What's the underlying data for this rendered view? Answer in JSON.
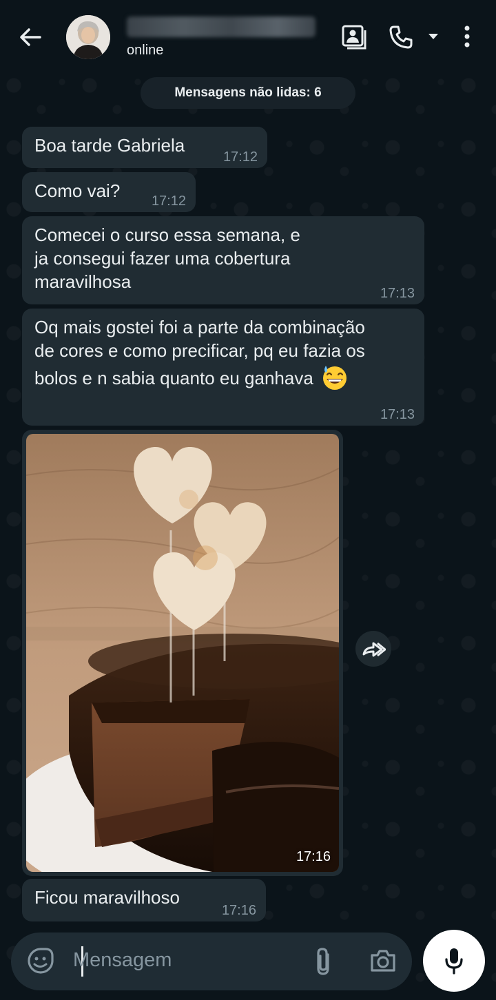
{
  "header": {
    "status": "online",
    "icons": [
      "back-arrow-icon",
      "contact-card-icon",
      "phone-icon",
      "dropdown-caret-icon",
      "more-vert-icon"
    ]
  },
  "chat": {
    "unread_label": "Mensagens não lidas: 6",
    "messages": [
      {
        "text": "Boa tarde Gabriela",
        "time": "17:12"
      },
      {
        "text": "Como vai?",
        "time": "17:12"
      },
      {
        "lines": [
          "Comecei o curso essa semana, e",
          "ja consegui fazer uma cobertura",
          "maravilhosa"
        ],
        "time": "17:13"
      },
      {
        "lines": [
          "Oq mais gostei foi a parte da combinação",
          "de cores e como precificar, pq eu fazia os",
          "bolos e n sabia quanto eu ganhava"
        ],
        "emoji": "grinning-sweat-emoji",
        "time": "17:13"
      },
      {
        "image": "chocolate-cake-photo",
        "time": "17:16"
      },
      {
        "text": "Ficou maravilhoso",
        "time": "17:16"
      }
    ]
  },
  "input": {
    "placeholder": "Mensagem",
    "icons": [
      "sticker-icon",
      "attach-icon",
      "camera-icon",
      "mic-icon"
    ]
  },
  "colors": {
    "background": "#0b141a",
    "bubble": "#202c33",
    "timestamp": "#8696a0",
    "input_bar": "#1f2c34"
  }
}
